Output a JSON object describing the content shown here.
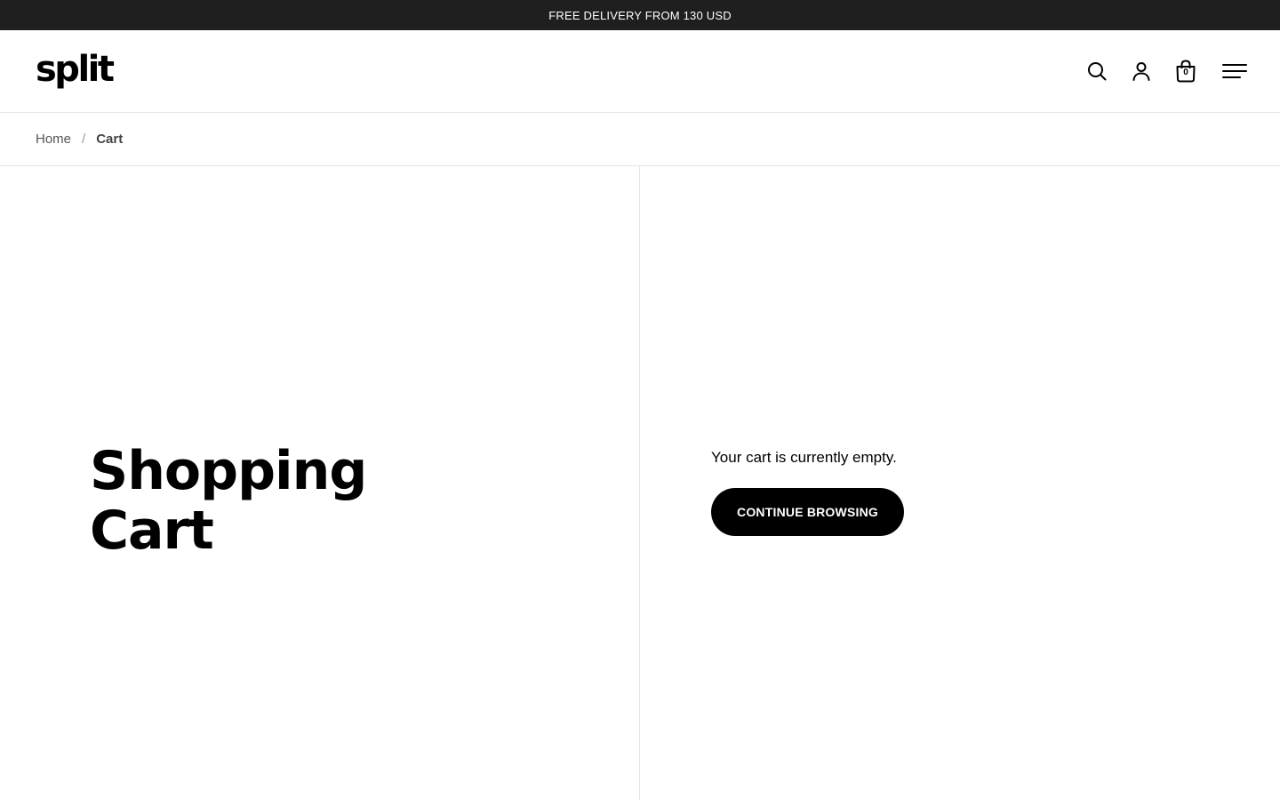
{
  "announcement": {
    "text": "FREE DELIVERY FROM 130 USD"
  },
  "header": {
    "logo_text": "split",
    "icons": [
      "search-icon",
      "account-icon",
      "cart-icon",
      "menu-icon"
    ],
    "cart_count": "0"
  },
  "breadcrumb": {
    "items": [
      {
        "label": "Home"
      },
      {
        "label": "Cart"
      }
    ],
    "separator": "/"
  },
  "main": {
    "title": "Shopping Cart",
    "empty_message": "Your cart is currently empty.",
    "continue_label": "CONTINUE BROWSING"
  },
  "colors": {
    "announcement_bg": "#1f1f1f",
    "button_bg": "#000000",
    "border": "#e5e5e5"
  }
}
